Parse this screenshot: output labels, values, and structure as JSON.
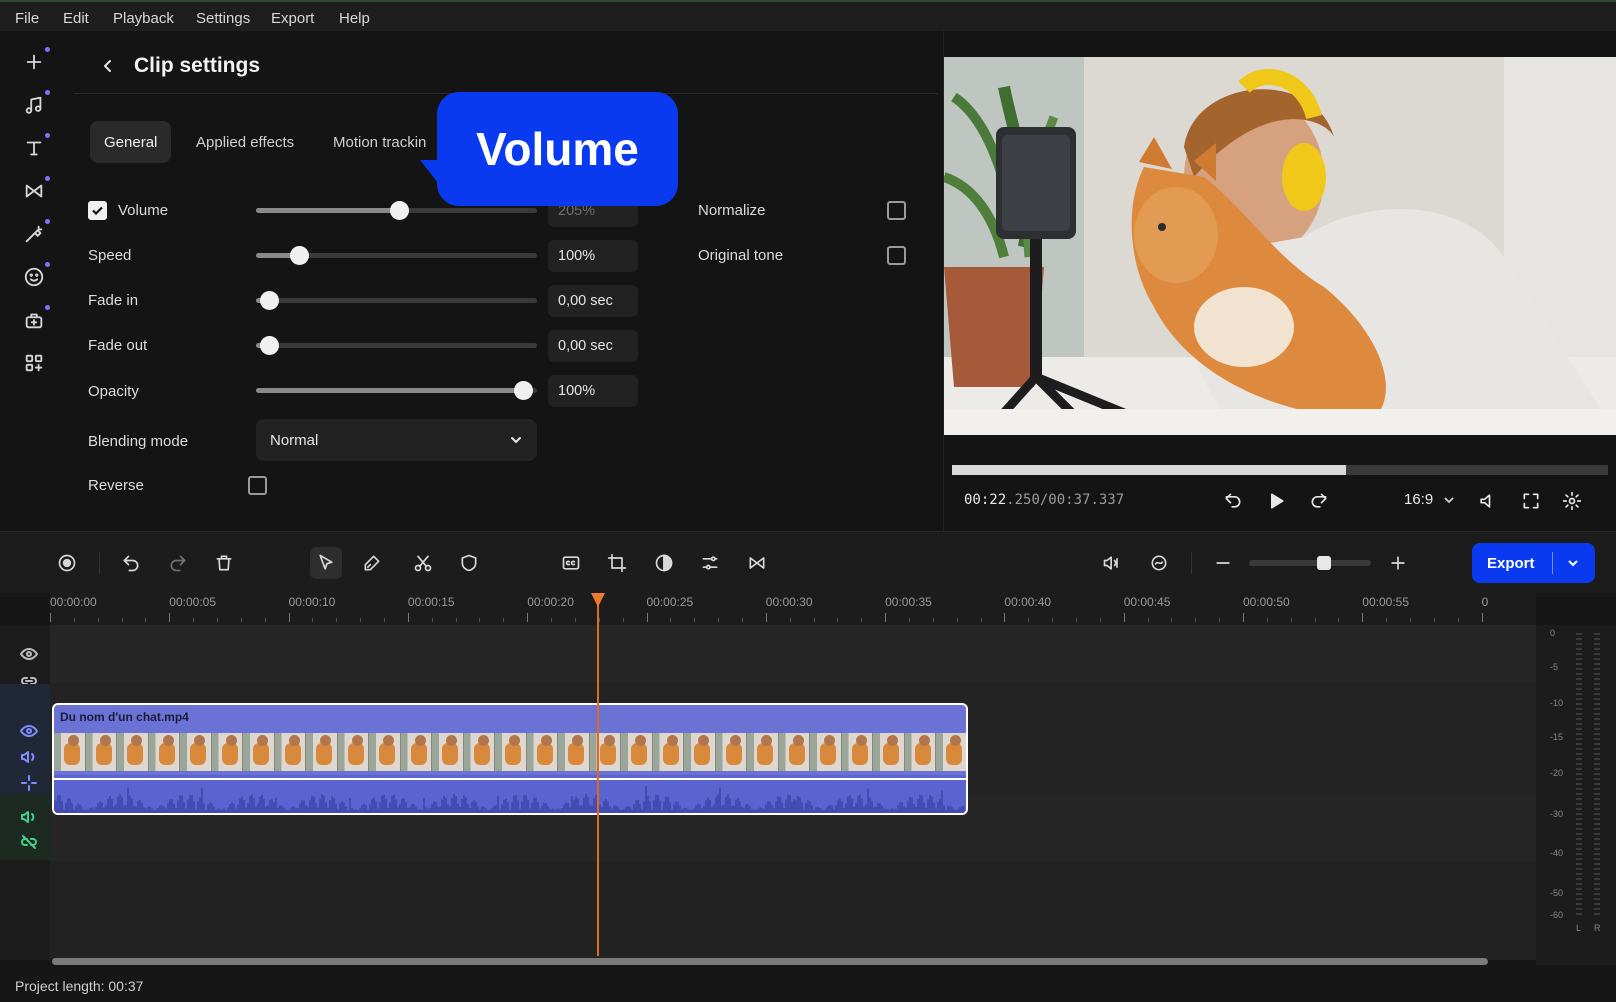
{
  "menu": [
    "File",
    "Edit",
    "Playback",
    "Settings",
    "Export",
    "Help"
  ],
  "rail": {
    "icons": [
      "add-media-icon",
      "music-icon",
      "titles-icon",
      "transitions-icon",
      "filters-icon",
      "stickers-icon",
      "more-tools-icon",
      "widgets-icon"
    ]
  },
  "panel": {
    "title": "Clip settings",
    "tabs": [
      "General",
      "Applied effects",
      "Motion trackin"
    ],
    "active_tab": "General",
    "volume": {
      "label": "Volume",
      "value": "205%",
      "checked": true,
      "level": 0.51
    },
    "speed": {
      "label": "Speed",
      "value": "100%",
      "level": 0.12
    },
    "fade_in": {
      "label": "Fade in",
      "value": "0,00 sec",
      "level": 0.0
    },
    "fade_out": {
      "label": "Fade out",
      "value": "0,00 sec",
      "level": 0.0
    },
    "opacity": {
      "label": "Opacity",
      "value": "100%",
      "level": 1.0
    },
    "blending": {
      "label": "Blending mode",
      "value": "Normal"
    },
    "reverse": {
      "label": "Reverse",
      "checked": false
    },
    "normalize": {
      "label": "Normalize",
      "checked": false
    },
    "original_tone": {
      "label": "Original tone",
      "checked": false
    }
  },
  "callout": {
    "text": "Volume",
    "color": "#0a3af0"
  },
  "preview": {
    "current_time": "00:22",
    "current_ms": ".250",
    "total_time": "/00:37.337",
    "progress": 0.6,
    "aspect": "16:9"
  },
  "toolbar": {
    "export_label": "Export",
    "accent": "#0a3af0"
  },
  "ruler": {
    "labels": [
      "00:00:00",
      "00:00:05",
      "00:00:10",
      "00:00:15",
      "00:00:20",
      "00:00:25",
      "00:00:30",
      "00:00:35",
      "00:00:40",
      "00:00:45",
      "00:00:50",
      "00:00:55",
      "0"
    ]
  },
  "clip": {
    "name": "Du nom d'un chat.mp4",
    "color": "#6b72d6"
  },
  "meter": {
    "labels": [
      "0",
      "-5",
      "-10",
      "-15",
      "-20",
      "-30",
      "-40",
      "-50",
      "-60"
    ],
    "channels": [
      "L",
      "R"
    ]
  },
  "status": {
    "project_length": "Project length: 00:37"
  }
}
